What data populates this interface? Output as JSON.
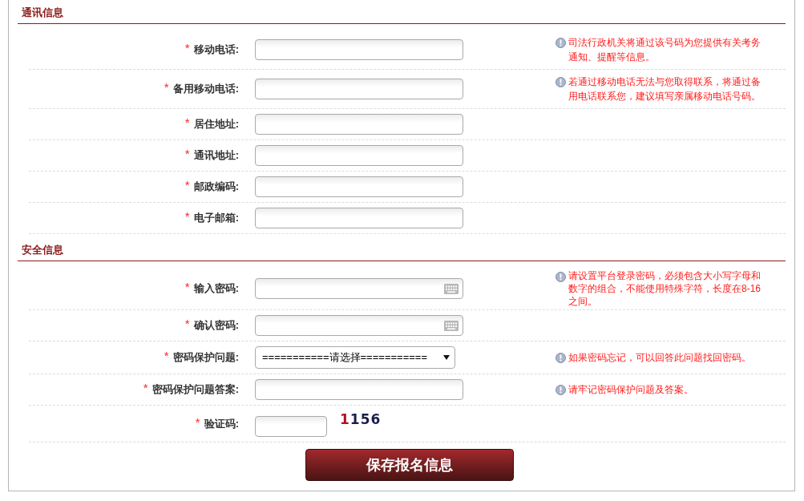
{
  "sections": [
    {
      "title": "通讯信息",
      "fields": [
        {
          "required_mark": "*",
          "label": "移动电话:",
          "kind": "text",
          "hint": "司法行政机关将通过该号码为您提供有关考务通知、提醒等信息。"
        },
        {
          "required_mark": "*",
          "label": "备用移动电话:",
          "kind": "text",
          "hint": "若通过移动电话无法与您取得联系，将通过备用电话联系您，建议填写亲属移动电话号码。"
        },
        {
          "required_mark": "*",
          "label": "居住地址:",
          "kind": "text"
        },
        {
          "required_mark": "*",
          "label": "通讯地址:",
          "kind": "text"
        },
        {
          "required_mark": "*",
          "label": "邮政编码:",
          "kind": "text"
        },
        {
          "required_mark": "*",
          "label": "电子邮箱:",
          "kind": "text"
        }
      ]
    },
    {
      "title": "安全信息",
      "fields": [
        {
          "required_mark": "*",
          "label": "输入密码:",
          "kind": "password",
          "hint": "请设置平台登录密码，必须包含大小写字母和数字的组合，不能使用特殊字符，长度在8-16之间。"
        },
        {
          "required_mark": "*",
          "label": "确认密码:",
          "kind": "password"
        },
        {
          "required_mark": "*",
          "label": "密码保护问题:",
          "kind": "select",
          "value": "===========请选择===========",
          "hint": "如果密码忘记，可以回答此问题找回密码。"
        },
        {
          "required_mark": "*",
          "label": "密码保护问题答案:",
          "kind": "text",
          "hint": "请牢记密码保护问题及答案。"
        },
        {
          "required_mark": "*",
          "label": "验证码:",
          "kind": "captcha",
          "captcha": [
            {
              "text": "1",
              "color": "#b01020"
            },
            {
              "text": "156",
              "color": "#1a1f4a"
            }
          ]
        }
      ]
    }
  ],
  "submit": "保存报名信息"
}
